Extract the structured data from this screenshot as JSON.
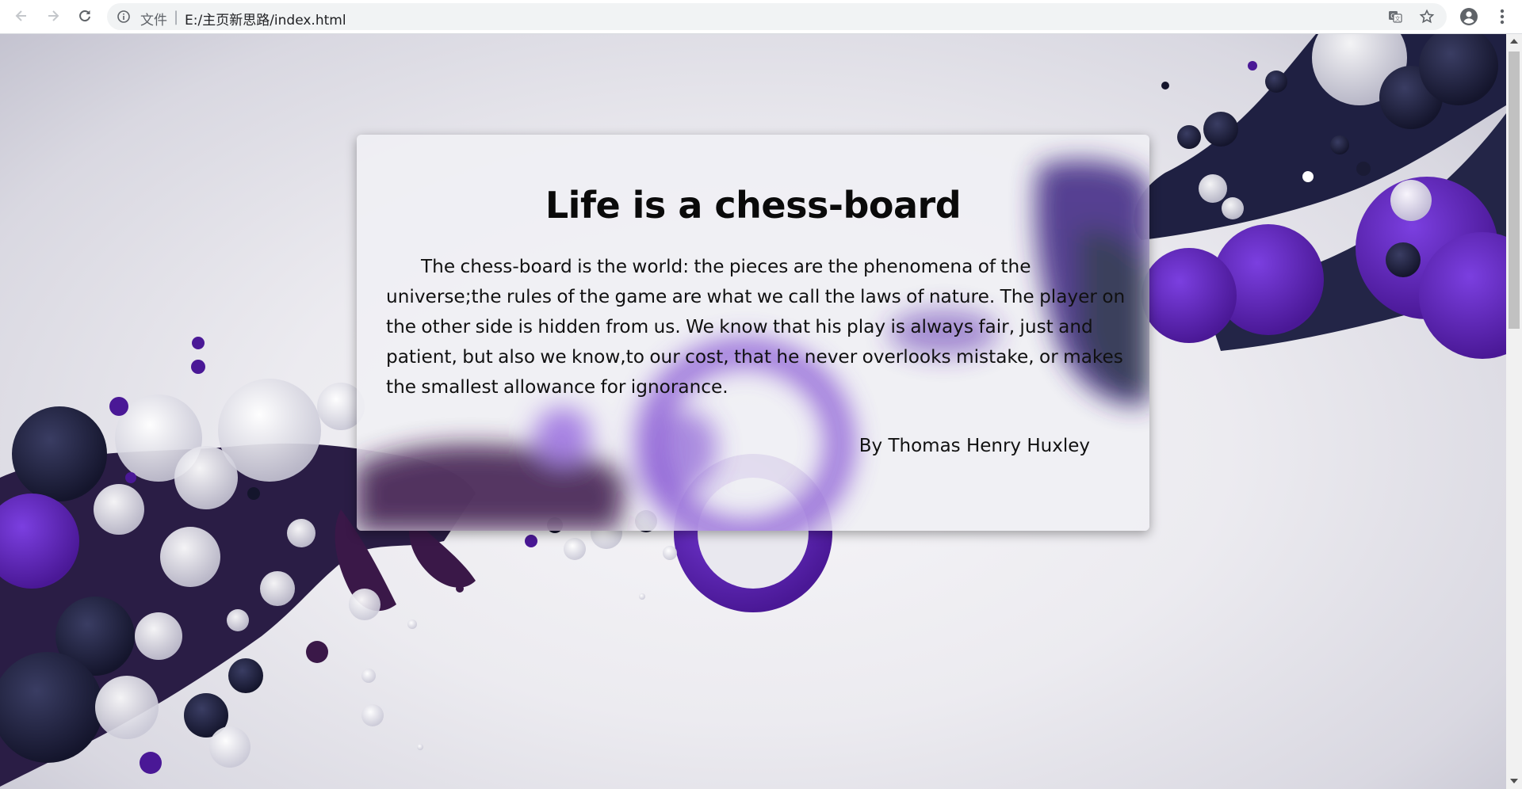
{
  "browser": {
    "scheme_label": "文件",
    "separator": "|",
    "url": "E:/主页新思路/index.html",
    "icons": [
      "back-arrow-icon",
      "forward-arrow-icon",
      "reload-icon",
      "info-icon",
      "translate-icon",
      "star-icon",
      "account-icon",
      "kebab-menu-icon"
    ]
  },
  "page": {
    "title": "Life is a chess-board",
    "body": "The chess-board is the world: the pieces are the phenomena of the universe;the rules of the game are what we call the laws of nature. The player on the other side is hidden from us. We know that his play is always fair, just and patient, but also we know,to our cost, that he never overlooks mistake, or makes the smallest allowance for ignorance.",
    "author": "By Thomas Henry Huxley"
  },
  "colors": {
    "purple": "#5a1fb0",
    "navy": "#1b1d3a",
    "plum": "#3a1848",
    "light": "#e6e5ec"
  }
}
